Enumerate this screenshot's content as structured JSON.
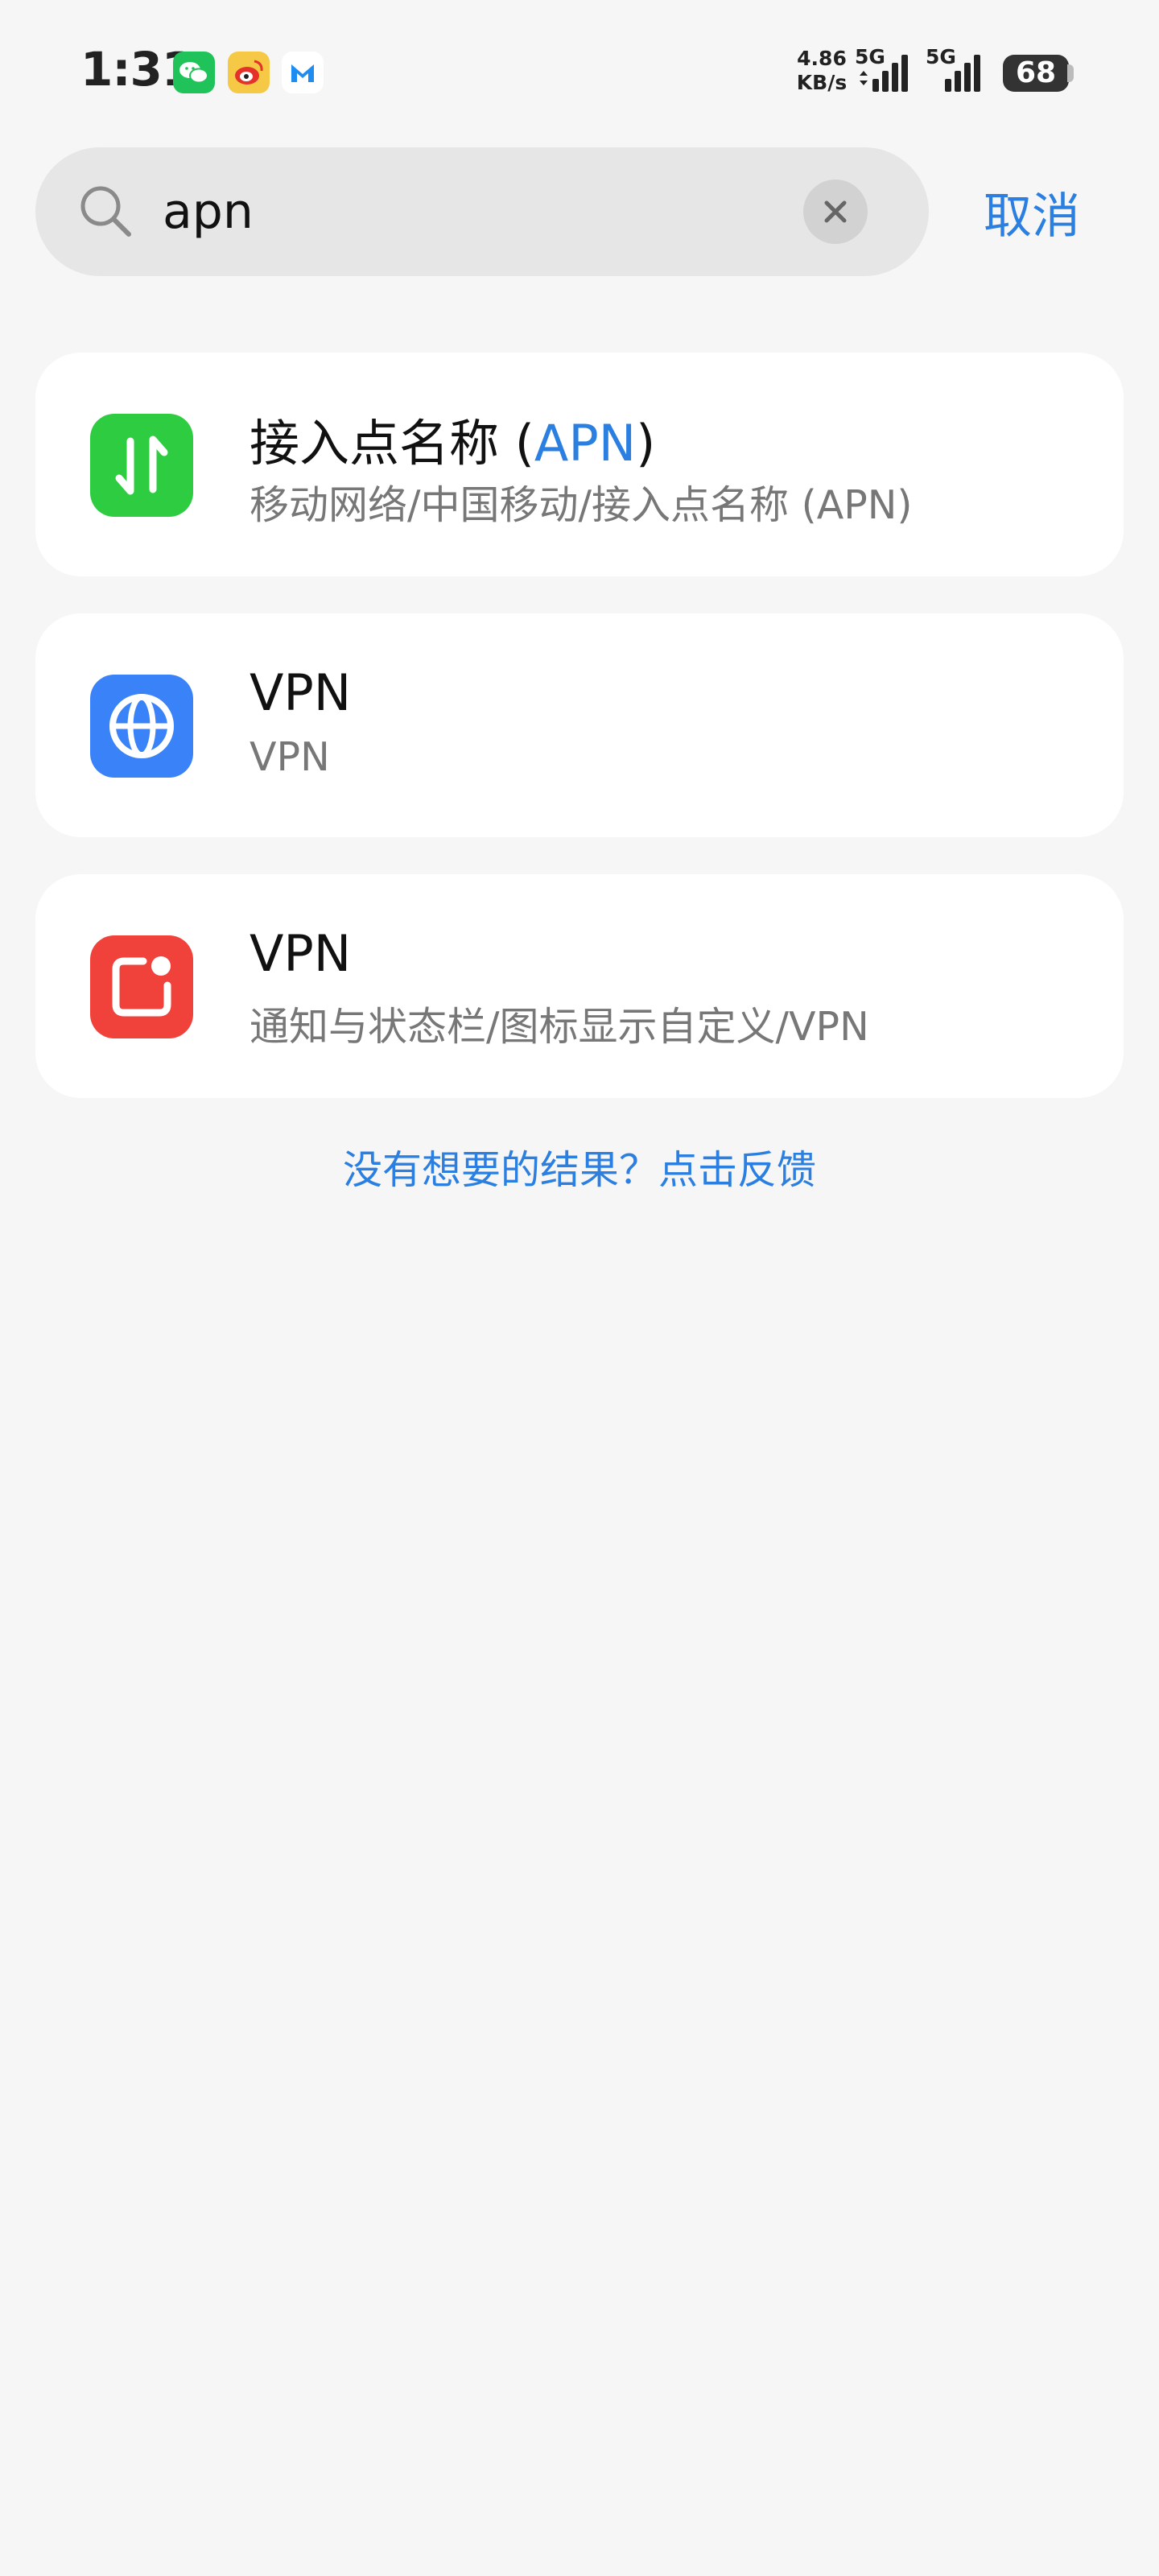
{
  "status_bar": {
    "time": "1:31",
    "notification_icons": [
      "wechat-icon",
      "weibo-icon",
      "mail-app-icon"
    ],
    "net_speed_value": "4.86",
    "net_speed_unit": "KB/s",
    "sim1_label": "5G",
    "sim2_label": "5G",
    "battery_percent": "68"
  },
  "search": {
    "query": "apn",
    "placeholder": "",
    "cancel_label": "取消"
  },
  "results": [
    {
      "title_prefix": "接入点名称 (",
      "title_highlight": "APN",
      "title_suffix": ")",
      "subtitle": "移动网络/中国移动/接入点名称 (APN)",
      "icon": "data-transfer-icon",
      "icon_color": "#2ecc40"
    },
    {
      "title": "VPN",
      "subtitle": "VPN",
      "icon": "globe-icon",
      "icon_color": "#3a82f7"
    },
    {
      "title": "VPN",
      "subtitle": "通知与状态栏/图标显示自定义/VPN",
      "icon": "notification-badge-icon",
      "icon_color": "#f0413a"
    }
  ],
  "feedback_link": "没有想要的结果？点击反馈",
  "colors": {
    "accent": "#2a7fe0",
    "background": "#f6f6f6",
    "card": "#ffffff"
  }
}
